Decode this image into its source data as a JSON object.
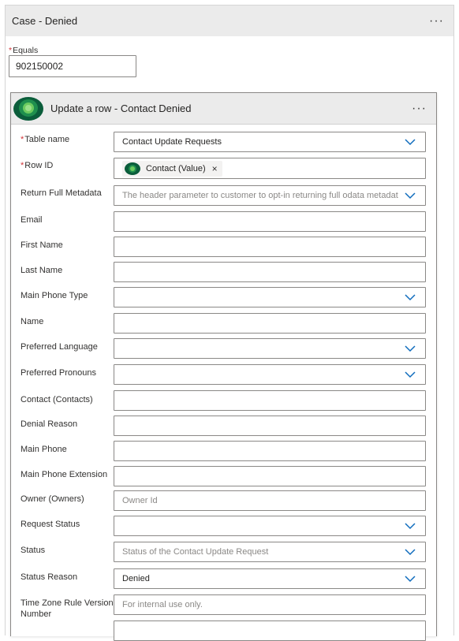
{
  "case": {
    "title": "Case - Denied",
    "more_label": "···",
    "equals_label": "Equals",
    "equals_value": "902150002"
  },
  "action": {
    "title": "Update a row - Contact Denied",
    "more_label": "···",
    "logo_icon": "dataverse-icon"
  },
  "fields": {
    "table_name": {
      "label": "Table name",
      "value": "Contact Update Requests"
    },
    "row_id": {
      "label": "Row ID",
      "token": "Contact (Value)",
      "token_remove": "×"
    },
    "return_full_metadata": {
      "label": "Return Full Metadata",
      "placeholder": "The header parameter to customer to opt-in returning full odata metadat"
    },
    "email": {
      "label": "Email"
    },
    "first_name": {
      "label": "First Name"
    },
    "last_name": {
      "label": "Last Name"
    },
    "main_phone_type": {
      "label": "Main Phone Type"
    },
    "name": {
      "label": "Name"
    },
    "preferred_language": {
      "label": "Preferred Language"
    },
    "preferred_pronouns": {
      "label": "Preferred Pronouns"
    },
    "contact": {
      "label": "Contact (Contacts)"
    },
    "denial_reason": {
      "label": "Denial Reason"
    },
    "main_phone": {
      "label": "Main Phone"
    },
    "main_phone_extension": {
      "label": "Main Phone Extension"
    },
    "owner": {
      "label": "Owner (Owners)",
      "placeholder": "Owner Id"
    },
    "request_status": {
      "label": "Request Status"
    },
    "status": {
      "label": "Status",
      "placeholder": "Status of the Contact Update Request"
    },
    "status_reason": {
      "label": "Status Reason",
      "value": "Denied"
    },
    "time_zone_rule": {
      "label_line1": "Time Zone Rule Version",
      "label_line2": "Number",
      "placeholder": "For internal use only."
    }
  },
  "colors": {
    "header_bg": "#ebebeb",
    "chevron": "#0f6cbd",
    "required": "#d13438",
    "logo_dark": "#0b5d3b",
    "logo_light": "#6ccb5f"
  }
}
